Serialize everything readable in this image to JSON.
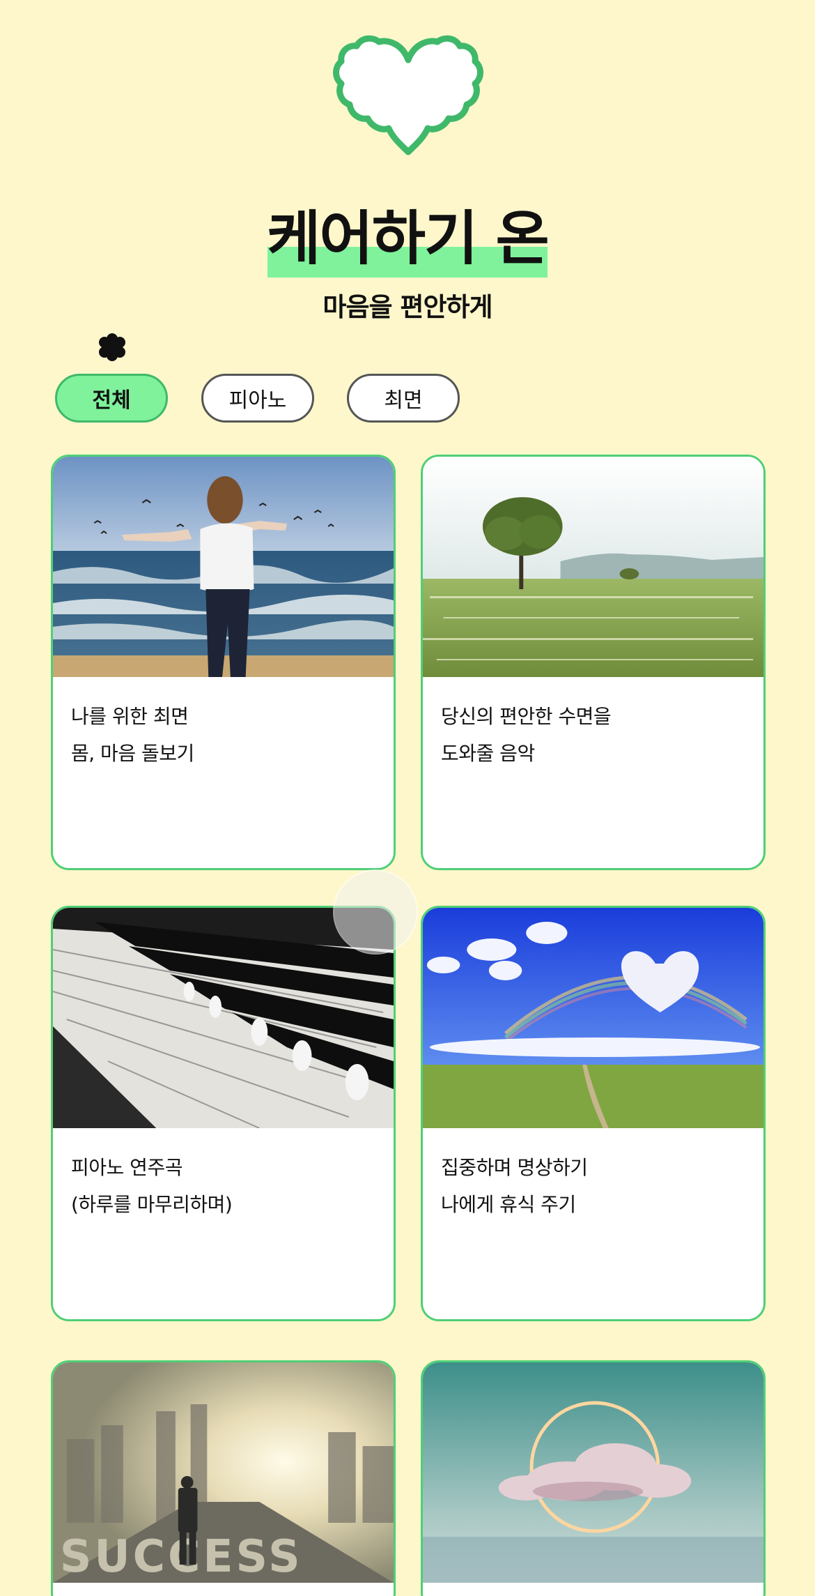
{
  "header": {
    "title": "케어하기 온",
    "subtitle": "마음을 편안하게",
    "logo_icon": "heart-flower-icon",
    "accent_color": "#7ff29b",
    "border_color": "#4fcf76",
    "background_color": "#fdf7cb"
  },
  "filters": {
    "active_index": 0,
    "items": [
      {
        "label": "전체"
      },
      {
        "label": "피아노"
      },
      {
        "label": "최면"
      }
    ]
  },
  "cards": [
    {
      "line1": "나를 위한 최면",
      "line2": "몸, 마음 돌보기",
      "image": "woman-at-beach"
    },
    {
      "line1": "당신의 편안한 수면을",
      "line2": "도와줄 음악",
      "image": "tree-in-meadow"
    },
    {
      "line1": "피아노 연주곡",
      "line2": "(하루를 마무리하며)",
      "image": "piano-keys"
    },
    {
      "line1": "집중하며 명상하기",
      "line2": "나에게 휴식 주기",
      "image": "heart-cloud-rainbow"
    },
    {
      "line1": "",
      "line2": "",
      "image": "success-road",
      "image_text": "SUCCESS"
    },
    {
      "line1": "",
      "line2": "",
      "image": "cloud-ring-sea"
    }
  ]
}
